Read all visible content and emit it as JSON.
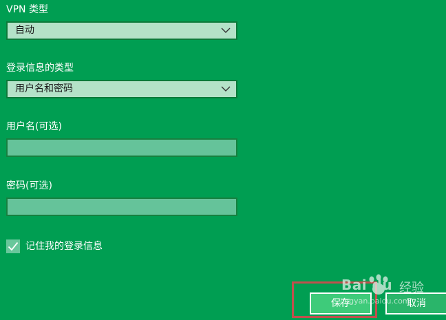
{
  "form": {
    "vpn_type": {
      "label": "VPN 类型",
      "selected": "自动"
    },
    "signin_type": {
      "label": "登录信息的类型",
      "selected": "用户名和密码"
    },
    "username": {
      "label": "用户名(可选)",
      "value": ""
    },
    "password": {
      "label": "密码(可选)",
      "value": ""
    },
    "remember": {
      "label": "记住我的登录信息",
      "checked": true
    }
  },
  "buttons": {
    "save_label": "保存",
    "cancel_label": "取消"
  },
  "watermark": {
    "logo": "Bai du",
    "suffix": "经验",
    "url": "jingyan.baidu.com"
  },
  "colors": {
    "background": "#009e52",
    "highlight": "#c0504d"
  }
}
